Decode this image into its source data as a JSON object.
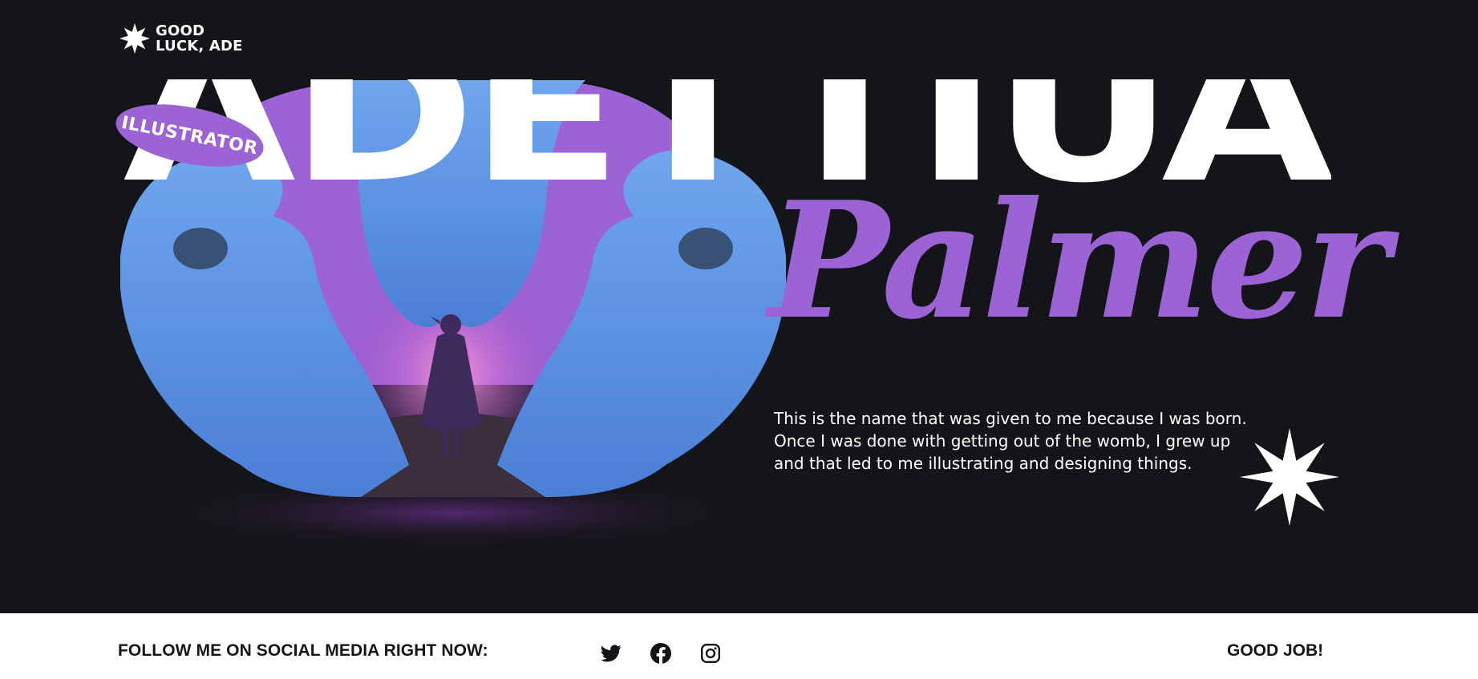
{
  "logo": {
    "line1": "GOOD",
    "line2": "LUCK, ADE",
    "icon": "starburst-icon"
  },
  "hero": {
    "first_name": "ADETTIUA",
    "badge": "ILLUSTRATOR",
    "last_name": "Palmer",
    "bio": [
      "This is the name that was given to me because I was born.",
      "Once I was done with getting out of the womb, I grew up",
      "and that led to me illustrating and designing things."
    ],
    "decor_icon": "starburst-icon"
  },
  "footer": {
    "follow_label": "FOLLOW ME ON SOCIAL MEDIA RIGHT NOW:",
    "social": [
      {
        "icon": "twitter-icon"
      },
      {
        "icon": "facebook-icon"
      },
      {
        "icon": "instagram-icon"
      }
    ],
    "sign_off": "GOOD JOB!"
  },
  "colors": {
    "background": "#141518",
    "accent": "#9b63d4",
    "hand_blue": "#5a93e3",
    "text": "#ffffff",
    "footer_bg": "#ffffff",
    "footer_text": "#141518"
  }
}
